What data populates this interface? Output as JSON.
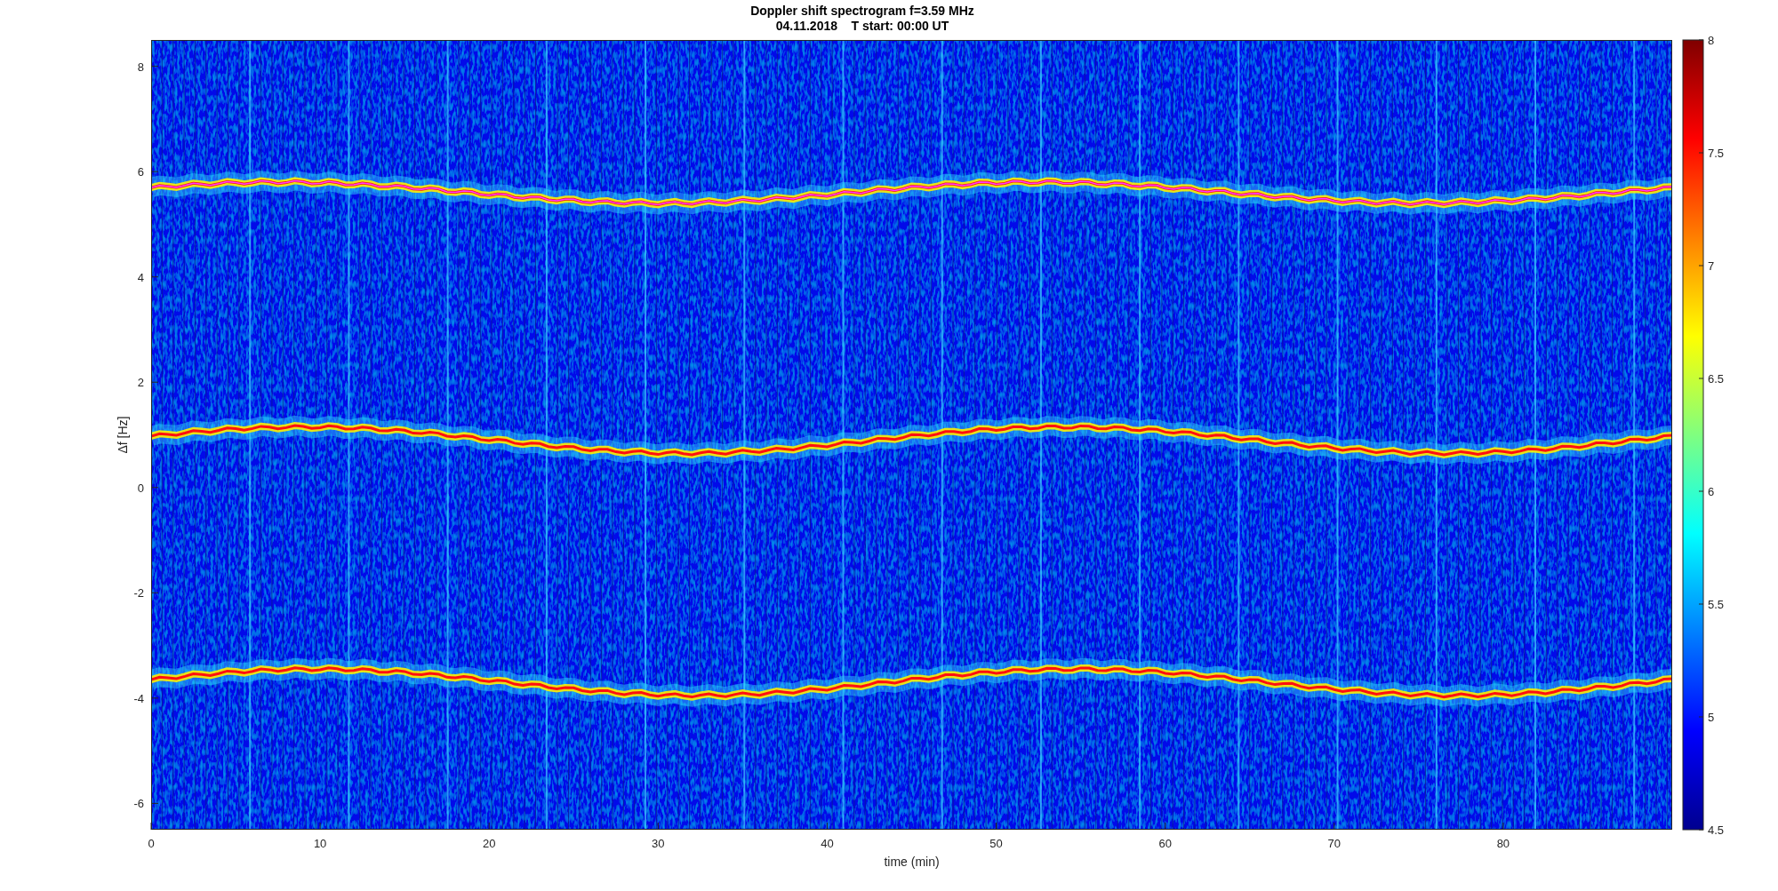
{
  "title": {
    "line_1": "Doppler shift spectrogram f=3.59 MHz",
    "line_2": "04.11.2018    T start: 00:00 UT"
  },
  "axes": {
    "xlabel": "time (min)",
    "ylabel": "Δf [Hz]",
    "xticks": [
      "0",
      "10",
      "20",
      "30",
      "40",
      "50",
      "60",
      "70",
      "80"
    ],
    "yticks": [
      "8",
      "6",
      "4",
      "2",
      "0",
      "-2",
      "-4",
      "-6"
    ]
  },
  "colorbar": {
    "ticks": [
      "8",
      "7.5",
      "7",
      "6.5",
      "6",
      "5.5",
      "5",
      "4.5"
    ]
  }
}
